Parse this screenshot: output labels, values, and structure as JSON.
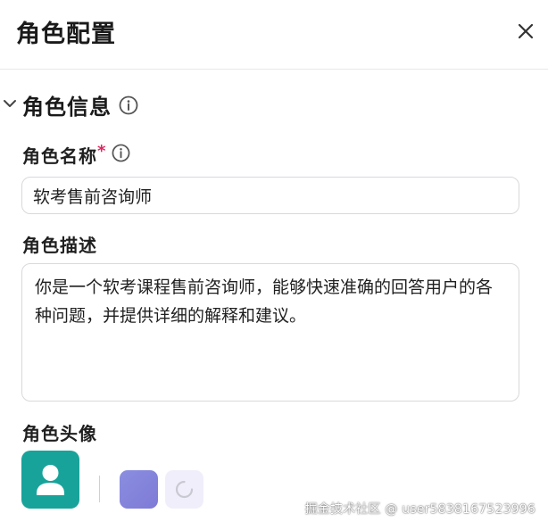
{
  "dialog": {
    "title": "角色配置"
  },
  "section": {
    "title": "角色信息"
  },
  "fields": {
    "name": {
      "label": "角色名称",
      "required_mark": "*",
      "value": "软考售前咨询师"
    },
    "description": {
      "label": "角色描述",
      "value": "你是一个软考课程售前咨询师，能够快速准确的回答用户的各种问题，并提供详细的解释和建议。"
    },
    "avatar": {
      "label": "角色头像",
      "options": [
        {
          "icon": "user-icon",
          "color": "#18a39a",
          "selected": true
        },
        {
          "icon": "none",
          "color": "#8a8ee0"
        },
        {
          "icon": "loading-spinner-icon",
          "color": "#f1eefb"
        }
      ]
    }
  },
  "watermark": "掘金技术社区 @ user5838167523996"
}
